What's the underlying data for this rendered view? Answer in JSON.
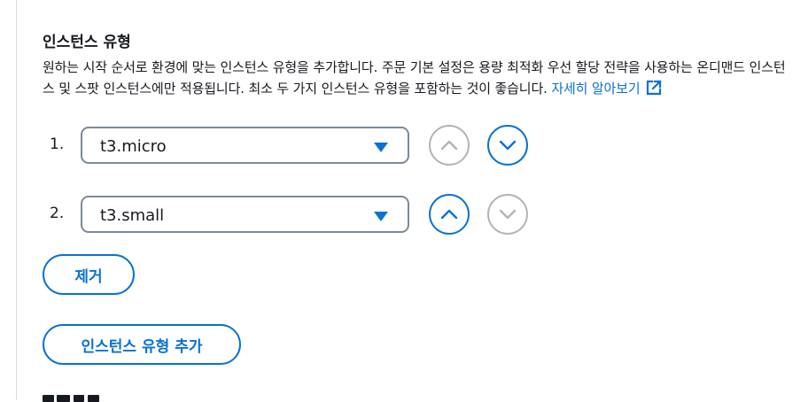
{
  "instance_types": {
    "title": "인스턴스 유형",
    "description": "원하는 시작 순서로 환경에 맞는 인스턴스 유형을 추가합니다. 주문 기본 설정은 용량 최적화 우선 할당 전략을 사용하는 온디맨드 인스턴스 및 스팟 인스턴스에만 적용됩니다. 최소 두 가지 인스턴스 유형을 포함하는 것이 좋습니다.",
    "learn_more_label": "자세히 알아보기",
    "learn_more_icon": "external-link-icon",
    "rows": [
      {
        "number": "1.",
        "selected_value": "t3.micro",
        "move_up_enabled": false,
        "move_down_enabled": true
      },
      {
        "number": "2.",
        "selected_value": "t3.small",
        "move_up_enabled": true,
        "move_down_enabled": false
      }
    ],
    "remove_button_label": "제거",
    "add_button_label": "인스턴스 유형 추가"
  },
  "colors": {
    "accent": "#0972d3",
    "text": "#16191f",
    "disabled": "#b4b4b4",
    "border": "#7d8998"
  },
  "icons": {
    "caret": "caret-down-icon",
    "up": "chevron-up-icon",
    "down": "chevron-down-icon"
  }
}
